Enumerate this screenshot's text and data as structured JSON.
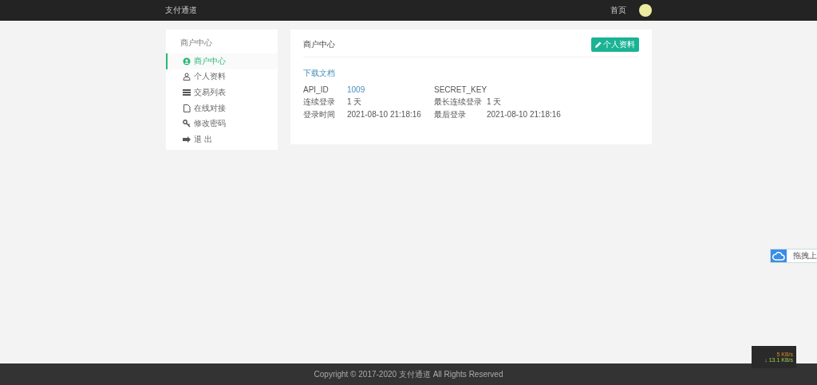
{
  "navbar": {
    "brand": "支付通道",
    "links": [
      {
        "label": "首页"
      }
    ]
  },
  "sidebar": {
    "heading": "商户中心",
    "items": [
      {
        "label": "商户中心",
        "selected": true
      },
      {
        "label": "个人资料",
        "selected": false
      },
      {
        "label": "交易列表",
        "selected": false
      },
      {
        "label": "在线对接",
        "selected": false
      },
      {
        "label": "修改密码",
        "selected": false
      },
      {
        "label": "退 出",
        "selected": false
      }
    ]
  },
  "main": {
    "title": "商户中心",
    "button": "个人资料",
    "doc_link": "下载文档",
    "rows": [
      [
        {
          "label": "API_ID",
          "value": "1009",
          "link": true
        },
        {
          "label": "SECRET_KEY"
        }
      ],
      [
        {
          "label": "连续登录",
          "value": "1 天"
        },
        {
          "label": "最长连续登录",
          "value": "1 天"
        }
      ],
      [
        {
          "label": "登录时间",
          "value": "2021-08-10 21:18:16"
        },
        {
          "label": "最后登录",
          "value": "2021-08-10 21:18:16"
        }
      ]
    ]
  },
  "upload_widget": {
    "label": "拖拽上"
  },
  "speed_meter": {
    "up": "5 KB/s",
    "down": "↓ 13.1 KB/s"
  },
  "footer": "Copyright © 2017-2020 支付通道 All Rights Reserved"
}
